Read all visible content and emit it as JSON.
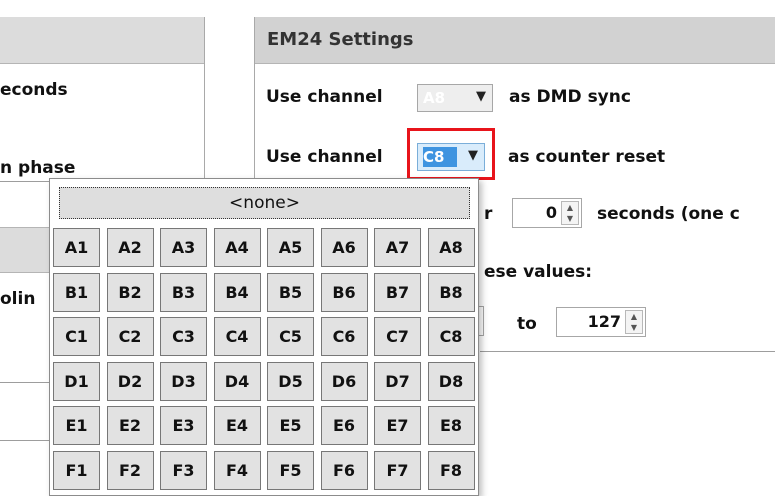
{
  "left_panel": {
    "line1": "econds",
    "line2": "n phase",
    "line3": "olin"
  },
  "em24": {
    "title": "EM24 Settings",
    "row1": {
      "prefix": "Use channel",
      "value": "A8",
      "suffix": "as DMD sync"
    },
    "row2": {
      "prefix": "Use channel",
      "value": "C8",
      "suffix": "as counter reset"
    },
    "row3": {
      "prefix": "r",
      "value": "0",
      "suffix": "seconds  (one c"
    },
    "row4": {
      "text": "ese values:"
    },
    "row5": {
      "to_label": "to",
      "value": "127"
    }
  },
  "dropdown": {
    "none_label": "<none>",
    "rows": [
      [
        "A1",
        "A2",
        "A3",
        "A4",
        "A5",
        "A6",
        "A7",
        "A8"
      ],
      [
        "B1",
        "B2",
        "B3",
        "B4",
        "B5",
        "B6",
        "B7",
        "B8"
      ],
      [
        "C1",
        "C2",
        "C3",
        "C4",
        "C5",
        "C6",
        "C7",
        "C8"
      ],
      [
        "D1",
        "D2",
        "D3",
        "D4",
        "D5",
        "D6",
        "D7",
        "D8"
      ],
      [
        "E1",
        "E2",
        "E3",
        "E4",
        "E5",
        "E6",
        "E7",
        "E8"
      ],
      [
        "F1",
        "F2",
        "F3",
        "F4",
        "F5",
        "F6",
        "F7",
        "F8"
      ]
    ]
  },
  "icons": {
    "dropdown_arrow": "chevron-down-icon",
    "spin_up": "spin-up-icon",
    "spin_down": "spin-down-icon"
  },
  "colors": {
    "highlight_selection": "#3f94e0",
    "annotation_box": "#e8141b"
  }
}
